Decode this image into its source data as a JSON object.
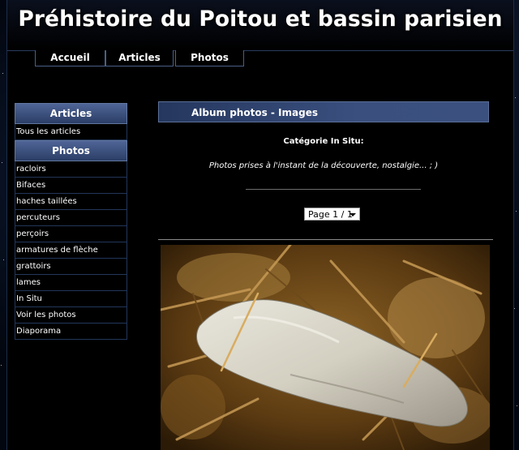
{
  "site": {
    "title": "Préhistoire du Poitou et bassin parisien"
  },
  "nav": [
    "Accueil",
    "Articles",
    "Photos"
  ],
  "sidebar": {
    "articles_heading": "Articles",
    "articles_items": [
      "Tous les articles"
    ],
    "photos_heading": "Photos",
    "photos_items": [
      "racloirs",
      "Bifaces",
      "haches taillées",
      "percuteurs",
      "perçoirs",
      "armatures de flèche",
      "grattoirs",
      "lames",
      "In Situ",
      "Voir les photos",
      "Diaporama"
    ]
  },
  "main": {
    "album_title": "Album photos - Images",
    "category_label": "Catégorie",
    "category_name": "In Situ:",
    "description": "Photos prises à l'instant de la découverte, nostalgie... ; )",
    "page_select": "Page 1 / 1"
  },
  "colors": {
    "page_bg": "#000000",
    "nav_border": "#4a5f86",
    "heading_bg": "#3a4f7e"
  }
}
